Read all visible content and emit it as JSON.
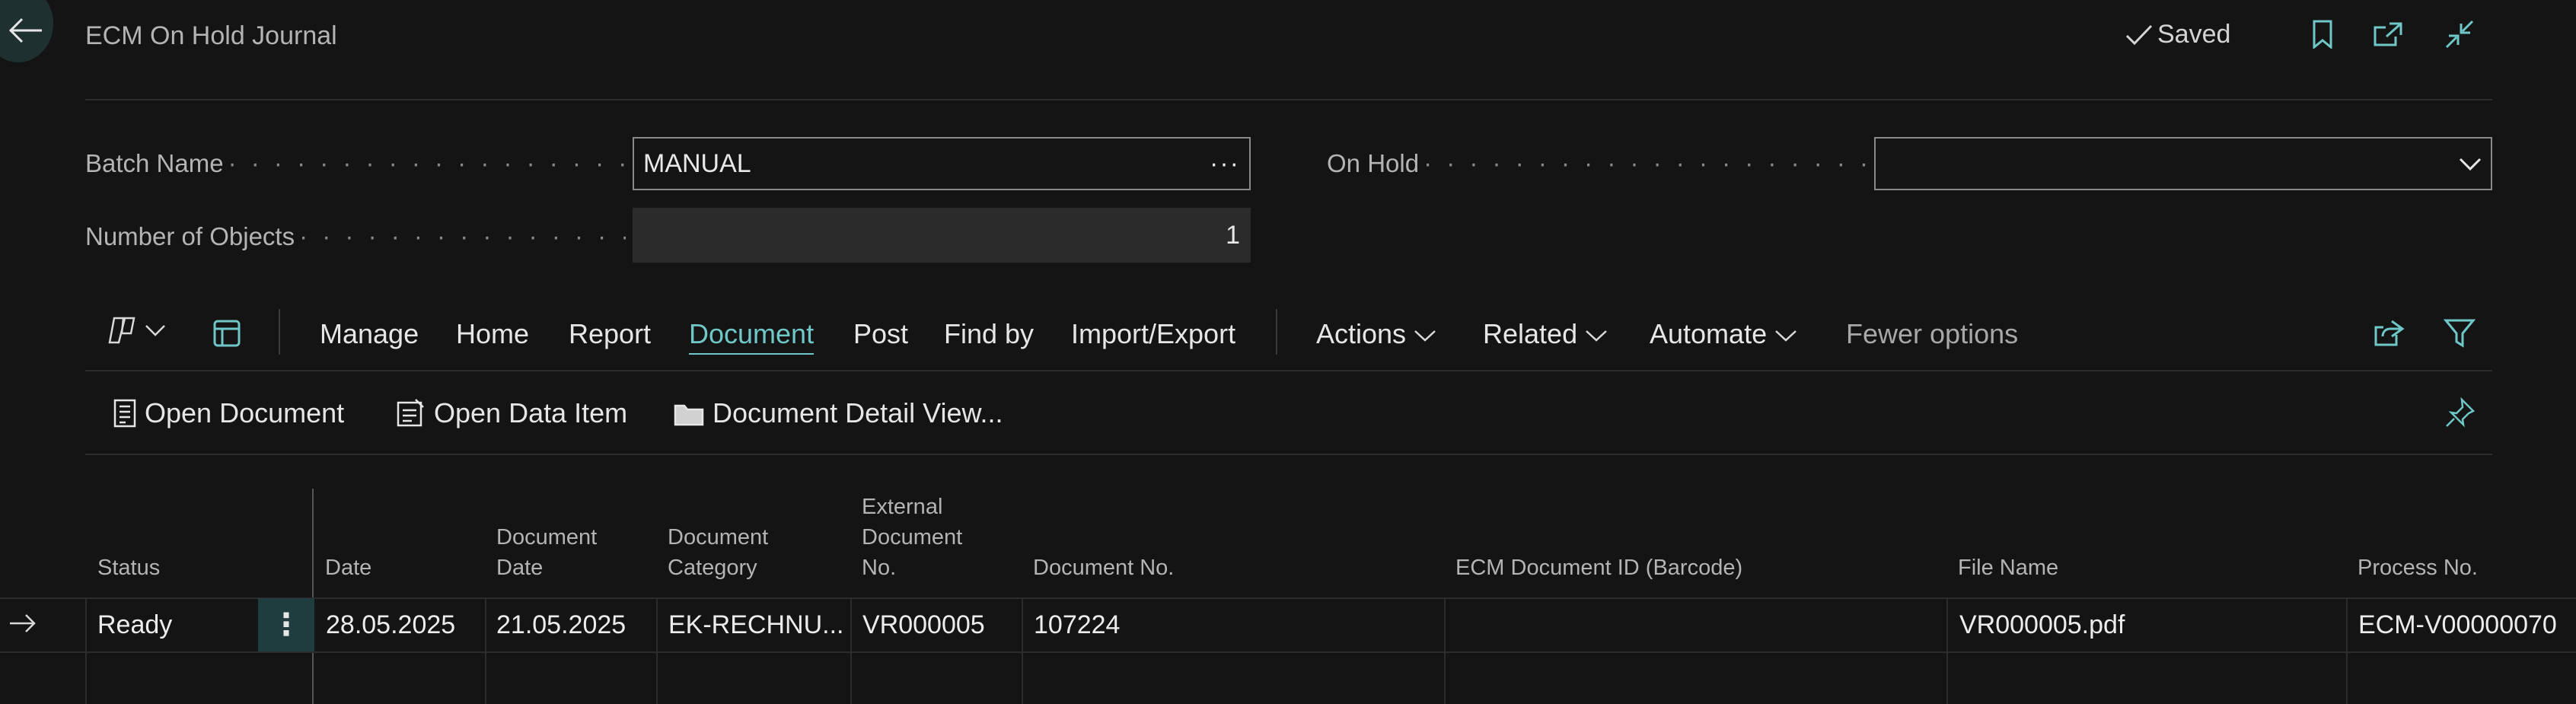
{
  "header": {
    "title": "ECM On Hold Journal",
    "saved_label": "Saved"
  },
  "fields": {
    "batch_name_label": "Batch Name",
    "batch_name_value": "MANUAL",
    "lookup_glyph": "···",
    "on_hold_label": "On Hold",
    "on_hold_value": "",
    "objects_label": "Number of Objects",
    "objects_value": "1",
    "dots": "· · · · · · · · · · · · · · · · · · · · · · · · · · · · · · · · · · · · · · · ·"
  },
  "action_bar": {
    "items": [
      "Manage",
      "Home",
      "Report",
      "Document",
      "Post",
      "Find by",
      "Import/Export"
    ],
    "active": "Document",
    "dropdowns": [
      "Actions",
      "Related",
      "Automate"
    ],
    "fewer_options": "Fewer options"
  },
  "sub_actions": [
    "Open Document",
    "Open Data Item",
    "Document Detail View..."
  ],
  "table": {
    "columns": [
      [
        "Status"
      ],
      [
        "Date"
      ],
      [
        "Document",
        "Date"
      ],
      [
        "Document",
        "Category"
      ],
      [
        "External",
        "Document",
        "No."
      ],
      [
        "Document No."
      ],
      [
        "ECM Document ID (Barcode)"
      ],
      [
        "File Name"
      ],
      [
        "Process No."
      ]
    ],
    "rows": [
      {
        "status": "Ready",
        "row_menu": "⋮",
        "date": "28.05.2025",
        "document_date": "21.05.2025",
        "document_category": "EK-RECHNU...",
        "external_document_no": "VR000005",
        "document_no": "107224",
        "ecm_document_id": "",
        "file_name": "VR000005.pdf",
        "process_no": "ECM-V00000070"
      }
    ]
  },
  "colors": {
    "background": "#141414",
    "accent": "#6fc7c7",
    "muted_text": "#b4b4b4"
  },
  "icons": [
    "back-arrow-icon",
    "checkmark-icon",
    "bookmark-icon",
    "open-new-window-icon",
    "collapse-icon",
    "copilot-icon",
    "chevron-down-icon",
    "page-layout-icon",
    "share-icon",
    "filter-icon",
    "document-icon",
    "data-item-icon",
    "folder-icon",
    "pin-icon",
    "row-arrow-icon"
  ]
}
